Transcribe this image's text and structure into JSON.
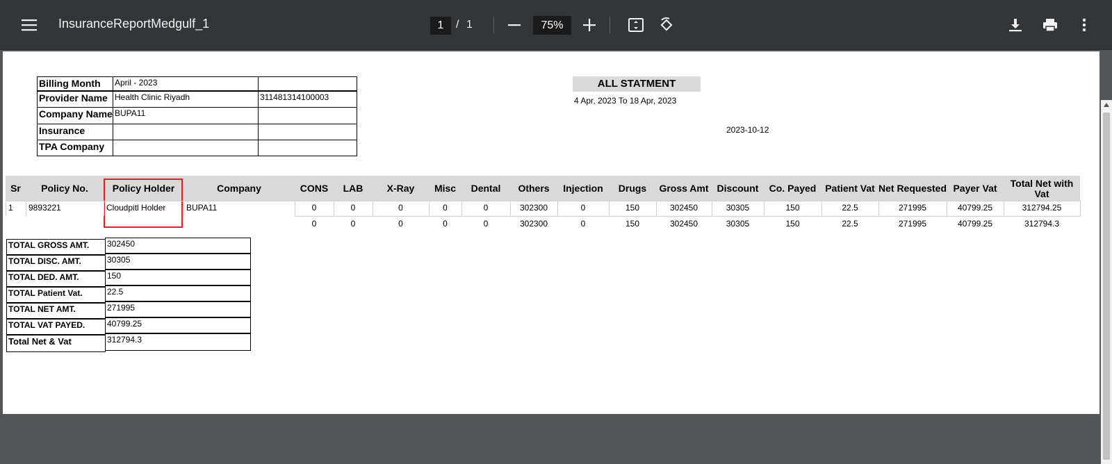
{
  "toolbar": {
    "title": "InsuranceReportMedgulf_1",
    "page_current": "1",
    "page_separator": "/",
    "page_total": "1",
    "zoom": "75%"
  },
  "header": {
    "billing_month_label": "Billing Month",
    "billing_month_value": "April - 2023",
    "provider_name_label": "Provider Name",
    "provider_name_value": "Health Clinic Riyadh",
    "provider_id": "311481314100003",
    "company_name_label": "Company Name",
    "company_name_value": "BUPA11",
    "insurance_label": "Insurance",
    "tpa_label": "TPA Company",
    "statement_title": "ALL STATMENT",
    "date_range": "4 Apr, 2023 To 18 Apr, 2023",
    "report_date": "2023-10-12"
  },
  "table": {
    "columns": [
      "Sr",
      "Policy No.",
      "Policy Holder",
      "Company",
      "CONS",
      "LAB",
      "X-Ray",
      "Misc",
      "Dental",
      "Others",
      "Injection",
      "Drugs",
      "Gross Amt",
      "Discount",
      "Co. Payed",
      "Patient Vat",
      "Net Requested",
      "Payer Vat",
      "Total Net with Vat"
    ],
    "row": [
      "1",
      "9893221",
      "Cloudpitl Holder",
      "BUPA11",
      "0",
      "0",
      "0",
      "0",
      "0",
      "302300",
      "0",
      "150",
      "302450",
      "30305",
      "150",
      "22.5",
      "271995",
      "40799.25",
      "312794.25"
    ],
    "totals": [
      "0",
      "0",
      "0",
      "0",
      "0",
      "302300",
      "0",
      "150",
      "302450",
      "30305",
      "150",
      "22.5",
      "271995",
      "40799.25",
      "312794.3"
    ]
  },
  "summary": [
    {
      "label": "TOTAL GROSS AMT.",
      "value": "302450"
    },
    {
      "label": "TOTAL DISC. AMT.",
      "value": "30305"
    },
    {
      "label": "TOTAL DED. AMT.",
      "value": "150"
    },
    {
      "label": "TOTAL Patient Vat.",
      "value": "22.5"
    },
    {
      "label": "TOTAL NET AMT.",
      "value": "271995"
    },
    {
      "label": "TOTAL VAT PAYED.",
      "value": "40799.25"
    },
    {
      "label": "Total Net & Vat",
      "value": "312794.3"
    }
  ]
}
